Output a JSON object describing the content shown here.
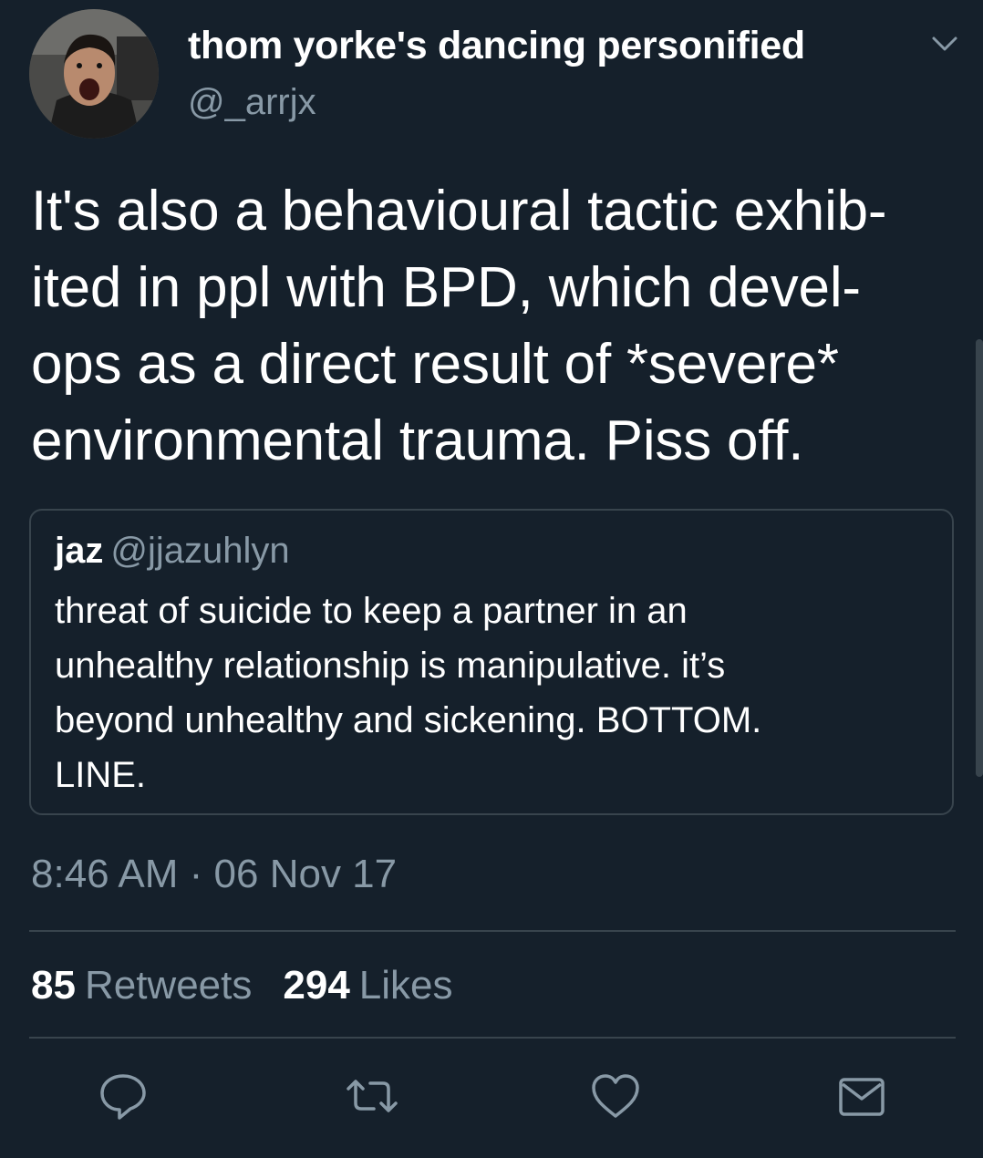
{
  "author": {
    "display_name": "thom yorke's dancing personified",
    "handle": "@_arrjx"
  },
  "tweet": {
    "lines": [
      "It's also a behavioural tactic exhib-",
      "ited in ppl with BPD, which devel-",
      "ops as a direct result of *severe*",
      "environmental trauma. Piss off."
    ]
  },
  "quote": {
    "name": "jaz",
    "handle": "@jjazuhlyn",
    "lines": [
      "threat of suicide to keep a partner in an",
      "unhealthy relationship is manipulative. it’s",
      "beyond unhealthy and sickening. BOTTOM.",
      "LINE."
    ]
  },
  "meta": {
    "timestamp": "8:46 AM · 06 Nov 17"
  },
  "stats": {
    "retweets_count": "85",
    "retweets_label": "Retweets",
    "likes_count": "294",
    "likes_label": "Likes"
  },
  "icons": {
    "menu": "chevron-down-icon",
    "reply": "reply-icon",
    "retweet": "retweet-icon",
    "like": "heart-icon",
    "message": "envelope-icon"
  },
  "colors": {
    "background": "#15202b",
    "secondary_text": "#8899a6",
    "border": "#38444d"
  }
}
